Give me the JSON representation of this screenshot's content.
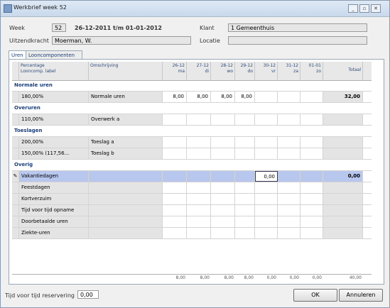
{
  "window": {
    "title": "Werkbrief week 52"
  },
  "header": {
    "week_label": "Week",
    "week_value": "52",
    "period": "26-12-2011 t/m 01-01-2012",
    "uitzendkracht_label": "Uitzendkracht",
    "uitzendkracht_value": "Moerman, W.",
    "klant_label": "Klant",
    "klant_value": "1 Gemeenthuis",
    "locatie_label": "Locatie",
    "locatie_value": ""
  },
  "tabs": [
    {
      "label": "Uren",
      "active": true
    },
    {
      "label": "Looncomponenten",
      "active": false
    }
  ],
  "columns": {
    "percentage": "Percentage",
    "looncomp": "Looncomp. label",
    "omschrijving": "Omschrijving",
    "days": [
      {
        "date": "26-12",
        "day": "ma"
      },
      {
        "date": "27-12",
        "day": "di"
      },
      {
        "date": "28-12",
        "day": "wo"
      },
      {
        "date": "29-12",
        "day": "do"
      },
      {
        "date": "30-12",
        "day": "vr"
      },
      {
        "date": "31-12",
        "day": "za"
      },
      {
        "date": "01-01",
        "day": "zo"
      }
    ],
    "totaal": "Totaal"
  },
  "groups": {
    "normale": "Normale uren",
    "overuren": "Overuren",
    "toeslagen": "Toeslagen",
    "overig": "Overig"
  },
  "rows": {
    "normale": [
      {
        "pct": "180,00%",
        "omschr": "Normale uren",
        "d": [
          "8,00",
          "8,00",
          "8,00",
          "8,00",
          "",
          "",
          ""
        ],
        "totaal": "32,00"
      }
    ],
    "overuren": [
      {
        "pct": "110,00%",
        "omschr": "Overwerk a"
      }
    ],
    "toeslagen": [
      {
        "pct": "200,00%",
        "omschr": "Toeslag a"
      },
      {
        "pct": "150,00%  (117,56...",
        "omschr": "Toeslag b"
      }
    ],
    "overig": [
      {
        "label": "Vakantiedagen",
        "d5": "0,00",
        "totaal": "0,00"
      },
      {
        "label": "Feestdagen"
      },
      {
        "label": "Kortverzuim"
      },
      {
        "label": "Tijd voor tijd opname"
      },
      {
        "label": "Doorbetaalde uren"
      },
      {
        "label": "Ziekte-uren"
      }
    ]
  },
  "totals": [
    "8,00",
    "8,00",
    "8,00",
    "8,00",
    "0,00",
    "0,00",
    "0,00"
  ],
  "totals_total": "40,00",
  "bottom": {
    "tvt_label": "Tijd voor tijd reservering",
    "tvt_value": "0,00",
    "ok_label": "OK",
    "cancel_label": "Annuleren"
  }
}
